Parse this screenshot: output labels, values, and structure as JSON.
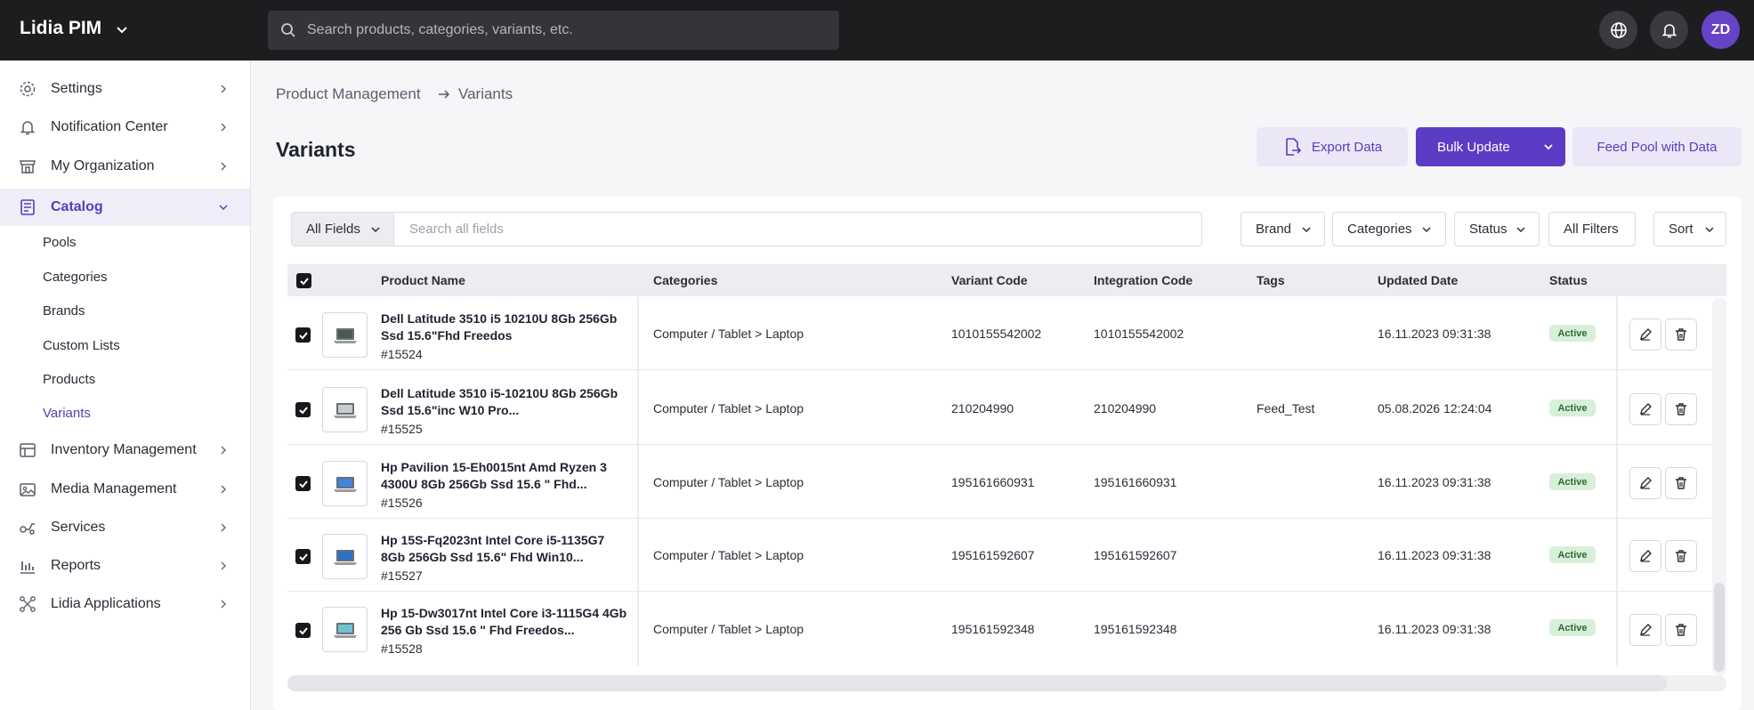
{
  "app": {
    "name": "Lidia PIM",
    "search_placeholder": "Search products, categories, variants, etc.",
    "avatar_initials": "ZD"
  },
  "sidebar": {
    "items": [
      {
        "label": "Settings",
        "icon": "gear-icon"
      },
      {
        "label": "Notification Center",
        "icon": "bell-icon"
      },
      {
        "label": "My Organization",
        "icon": "store-icon"
      },
      {
        "label": "Catalog",
        "icon": "catalog-icon"
      },
      {
        "label": "Inventory Management",
        "icon": "inventory-icon"
      },
      {
        "label": "Media Management",
        "icon": "media-icon"
      },
      {
        "label": "Services",
        "icon": "services-icon"
      },
      {
        "label": "Reports",
        "icon": "reports-icon"
      },
      {
        "label": "Lidia Applications",
        "icon": "apps-icon"
      }
    ],
    "catalog_sub": [
      "Pools",
      "Categories",
      "Brands",
      "Custom Lists",
      "Products",
      "Variants"
    ]
  },
  "breadcrumb": {
    "parent": "Product Management",
    "current": "Variants"
  },
  "page": {
    "title": "Variants",
    "export_label": "Export Data",
    "bulk_label": "Bulk Update",
    "feed_label": "Feed Pool with Data"
  },
  "filters": {
    "field_select": "All Fields",
    "search_placeholder": "Search all fields",
    "brand": "Brand",
    "categories": "Categories",
    "status": "Status",
    "all_filters": "All Filters",
    "sort": "Sort"
  },
  "table": {
    "columns": {
      "product_name": "Product Name",
      "categories": "Categories",
      "variant_code": "Variant Code",
      "integration_code": "Integration Code",
      "tags": "Tags",
      "updated_date": "Updated Date",
      "status": "Status"
    },
    "rows": [
      {
        "name": "Dell Latitude 3510 i5 10210U 8Gb 256Gb Ssd 15.6\"Fhd Freedos",
        "id": "#15524",
        "category": "Computer / Tablet > Laptop",
        "variant_code": "1010155542002",
        "integration_code": "1010155542002",
        "tags": "",
        "updated": "16.11.2023 09:31:38",
        "status": "Active"
      },
      {
        "name": "Dell Latitude 3510 i5-10210U 8Gb 256Gb Ssd 15.6\"inc W10 Pro...",
        "id": "#15525",
        "category": "Computer / Tablet > Laptop",
        "variant_code": "210204990",
        "integration_code": "210204990",
        "tags": "Feed_Test",
        "updated": "05.08.2026 12:24:04",
        "status": "Active"
      },
      {
        "name": "Hp Pavilion 15-Eh0015nt Amd Ryzen 3 4300U 8Gb 256Gb Ssd 15.6 \" Fhd...",
        "id": "#15526",
        "category": "Computer / Tablet > Laptop",
        "variant_code": "195161660931",
        "integration_code": "195161660931",
        "tags": "",
        "updated": "16.11.2023 09:31:38",
        "status": "Active"
      },
      {
        "name": "Hp 15S-Fq2023nt Intel Core i5-1135G7 8Gb 256Gb Ssd 15.6\" Fhd Win10...",
        "id": "#15527",
        "category": "Computer / Tablet > Laptop",
        "variant_code": "195161592607",
        "integration_code": "195161592607",
        "tags": "",
        "updated": "16.11.2023 09:31:38",
        "status": "Active"
      },
      {
        "name": "Hp 15-Dw3017nt Intel Core i3-1115G4 4Gb 256 Gb Ssd 15.6 \" Fhd Freedos...",
        "id": "#15528",
        "category": "Computer / Tablet > Laptop",
        "variant_code": "195161592348",
        "integration_code": "195161592348",
        "tags": "",
        "updated": "16.11.2023 09:31:38",
        "status": "Active"
      }
    ]
  },
  "colors": {
    "accent": "#5b3cc4",
    "topbar": "#1d1d1f",
    "active_badge": "#d8efd9"
  }
}
